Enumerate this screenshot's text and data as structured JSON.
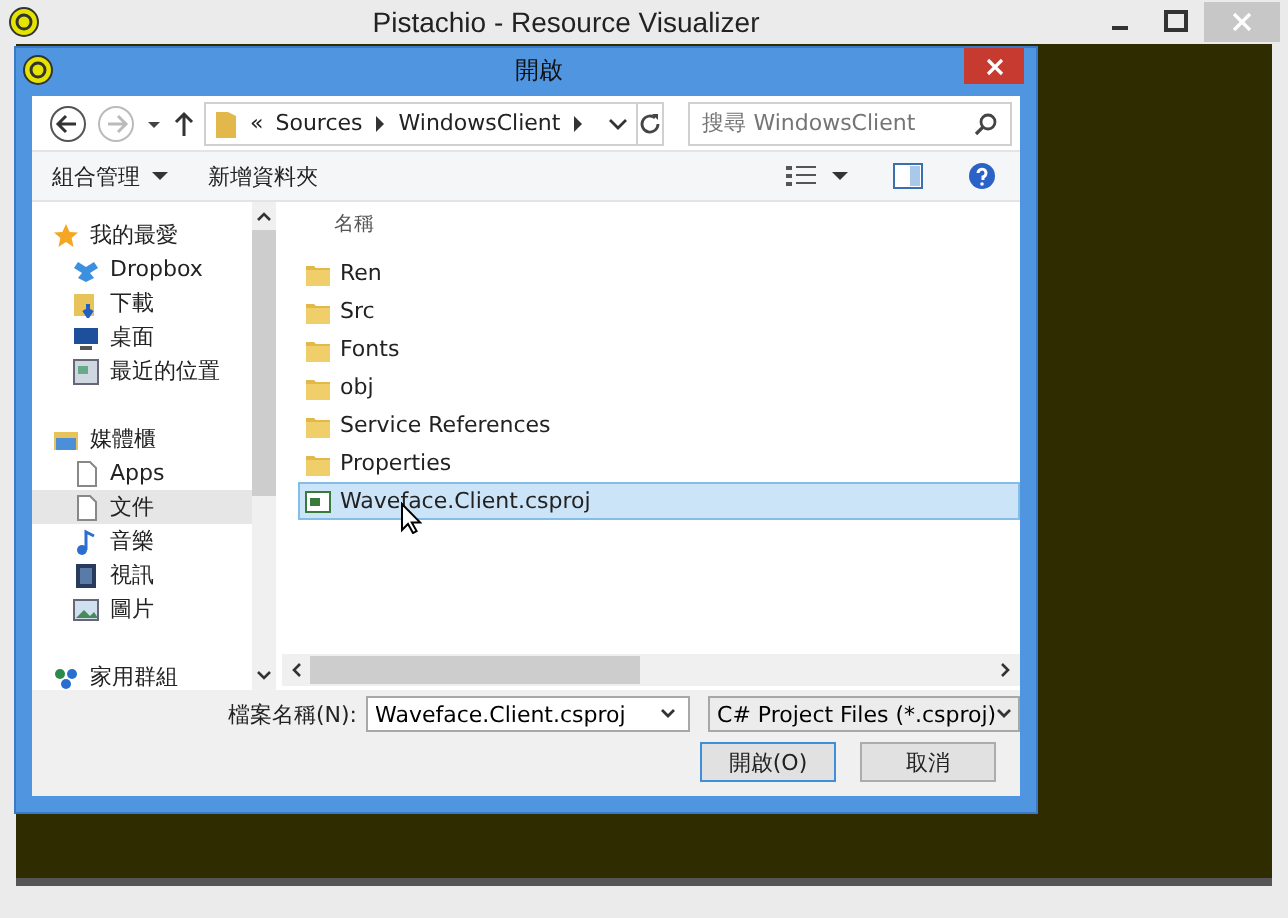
{
  "window": {
    "title": "Pistachio - Resource Visualizer"
  },
  "dialog": {
    "title": "開啟",
    "breadcrumb": {
      "overflow": "«",
      "parts": [
        "Sources",
        "WindowsClient"
      ]
    },
    "search": {
      "placeholder": "搜尋 WindowsClient"
    },
    "commands": [
      {
        "label": "組合管理",
        "dropdown": true
      },
      {
        "label": "新增資料夾",
        "dropdown": false
      }
    ],
    "sidebar": [
      {
        "label": "我的最愛",
        "kind": "star",
        "selected": false,
        "children": [
          {
            "label": "Dropbox",
            "kind": "dropbox",
            "selected": false
          },
          {
            "label": "下載",
            "kind": "download",
            "selected": false
          },
          {
            "label": "桌面",
            "kind": "desktop",
            "selected": false
          },
          {
            "label": "最近的位置",
            "kind": "recent",
            "selected": false
          }
        ]
      },
      {
        "label": "媒體櫃",
        "kind": "library",
        "selected": false,
        "children": [
          {
            "label": "Apps",
            "kind": "doc",
            "selected": false
          },
          {
            "label": "文件",
            "kind": "doc",
            "selected": true
          },
          {
            "label": "音樂",
            "kind": "music",
            "selected": false
          },
          {
            "label": "視訊",
            "kind": "video",
            "selected": false
          },
          {
            "label": "圖片",
            "kind": "image",
            "selected": false
          }
        ]
      },
      {
        "label": "家用群組",
        "kind": "homegroup",
        "selected": false
      }
    ],
    "columns": [
      "名稱"
    ],
    "files": [
      {
        "name": "Ren",
        "kind": "folder",
        "selected": false
      },
      {
        "name": "Src",
        "kind": "folder",
        "selected": false
      },
      {
        "name": "Fonts",
        "kind": "folder",
        "selected": false
      },
      {
        "name": "obj",
        "kind": "folder",
        "selected": false
      },
      {
        "name": "Service References",
        "kind": "folder",
        "selected": false
      },
      {
        "name": "Properties",
        "kind": "folder",
        "selected": false
      },
      {
        "name": "Waveface.Client.csproj",
        "kind": "csproj",
        "selected": true
      }
    ],
    "filename": {
      "label": "檔案名稱(N):",
      "value": "Waveface.Client.csproj"
    },
    "filetype": "C# Project Files (*.csproj)",
    "buttons": [
      {
        "label": "開啟(O)",
        "default": true
      },
      {
        "label": "取消",
        "default": false
      }
    ]
  }
}
